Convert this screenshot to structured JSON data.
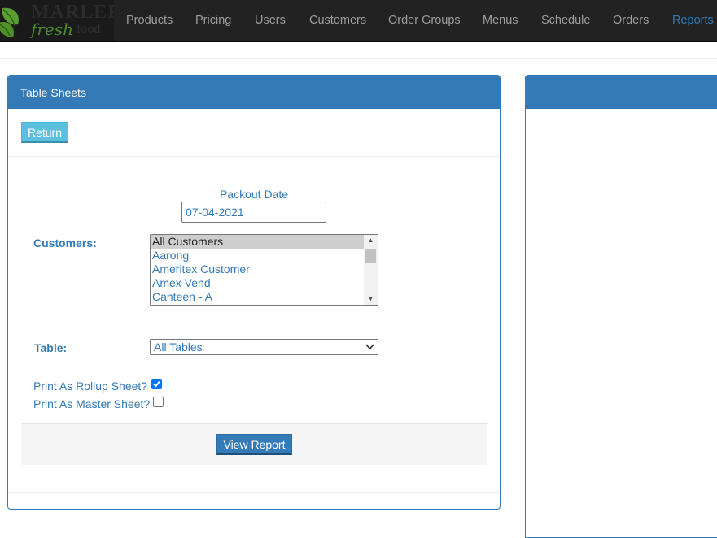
{
  "brand": {
    "line1": "MARLER",
    "line2": "fresh",
    "line3": "food"
  },
  "nav": {
    "items": [
      {
        "label": "Products"
      },
      {
        "label": "Pricing"
      },
      {
        "label": "Users"
      },
      {
        "label": "Customers"
      },
      {
        "label": "Order Groups"
      },
      {
        "label": "Menus"
      },
      {
        "label": "Schedule"
      },
      {
        "label": "Orders"
      },
      {
        "label": "Reports"
      }
    ],
    "active": "Reports"
  },
  "panel": {
    "title": "Table Sheets",
    "return_label": "Return"
  },
  "form": {
    "packout_label": "Packout Date",
    "packout_value": "07-04-2021",
    "customers_label": "Customers:",
    "customers_options": [
      {
        "label": "All Customers",
        "selected": true
      },
      {
        "label": "Aarong"
      },
      {
        "label": "Ameritex Customer"
      },
      {
        "label": "Amex Vend"
      },
      {
        "label": "Canteen - A"
      }
    ],
    "table_label": "Table:",
    "table_selected": "All Tables",
    "rollup_label": "Print As Rollup Sheet?",
    "rollup_checked": true,
    "master_label": "Print As Master Sheet?",
    "master_checked": false,
    "view_report_label": "View Report"
  },
  "colors": {
    "primary": "#337ab7",
    "info": "#5bc0de",
    "navbar": "#222222",
    "nav_text": "#9d9d9d",
    "checkbox": "#0075ff"
  },
  "icons": {
    "brand": "leaf-icon",
    "select": "chevron-down-icon",
    "checked": "checkmark-icon",
    "scroll_up": "triangle-up-icon",
    "scroll_down": "triangle-down-icon"
  }
}
